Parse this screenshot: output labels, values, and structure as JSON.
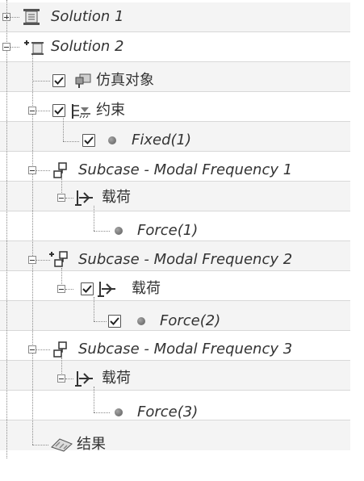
{
  "tree": {
    "solution1": {
      "label": "Solution 1"
    },
    "solution2": {
      "label": "Solution 2",
      "sim_object": {
        "label": "仿真对象"
      },
      "constraints": {
        "label": "约束",
        "fixed": {
          "label": "Fixed(1)"
        }
      },
      "subcase1": {
        "label": "Subcase - Modal Frequency 1",
        "loads": {
          "label": "载荷",
          "force": {
            "label": "Force(1)"
          }
        }
      },
      "subcase2": {
        "label": "Subcase - Modal Frequency 2",
        "loads": {
          "label": "载荷",
          "force": {
            "label": "Force(2)"
          }
        }
      },
      "subcase3": {
        "label": "Subcase - Modal Frequency 3",
        "loads": {
          "label": "载荷",
          "force": {
            "label": "Force(3)"
          }
        }
      },
      "results": {
        "label": "结果"
      }
    }
  },
  "icons": {
    "solution": "solution-icon",
    "active_solution": "active-solution-icon",
    "sim_object": "simulation-object-icon",
    "constraint_container": "constraint-container-icon",
    "subcase": "subcase-icon",
    "active_subcase": "active-subcase-icon",
    "load_container": "load-container-icon",
    "bullet": "item-bullet-icon",
    "results": "results-icon"
  },
  "colors": {
    "row_alt": "#f4f4f4",
    "row_border": "#d8d8d8",
    "text": "#333333"
  }
}
